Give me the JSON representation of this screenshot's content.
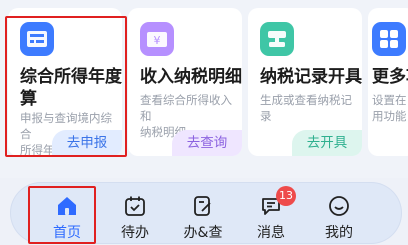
{
  "cards": [
    {
      "title_line1": "综合所得年度汇",
      "title_line2": "算",
      "desc_line1": "申报与查询境内综合",
      "desc_line2": "所得年度汇算",
      "action": "去申报"
    },
    {
      "title": "收入纳税明细",
      "desc_line1": "查看综合所得收入和",
      "desc_line2": "纳税明细",
      "action": "去查询"
    },
    {
      "title": "纳税记录开具",
      "desc_line1": "生成或查看纳税记录",
      "action": "去开具"
    },
    {
      "title": "更多功",
      "desc_line1": "设置在",
      "desc_line2": "用功能"
    }
  ],
  "tabs": [
    {
      "label": "首页",
      "icon": "home-icon"
    },
    {
      "label": "待办",
      "icon": "calendar-check-icon"
    },
    {
      "label": "办&查",
      "icon": "document-edit-icon"
    },
    {
      "label": "消息",
      "icon": "message-icon",
      "badge": "13"
    },
    {
      "label": "我的",
      "icon": "smile-icon"
    }
  ],
  "colors": {
    "active_tab": "#2f6bff",
    "highlight_border": "#e02020",
    "badge": "#ee4b4b"
  }
}
